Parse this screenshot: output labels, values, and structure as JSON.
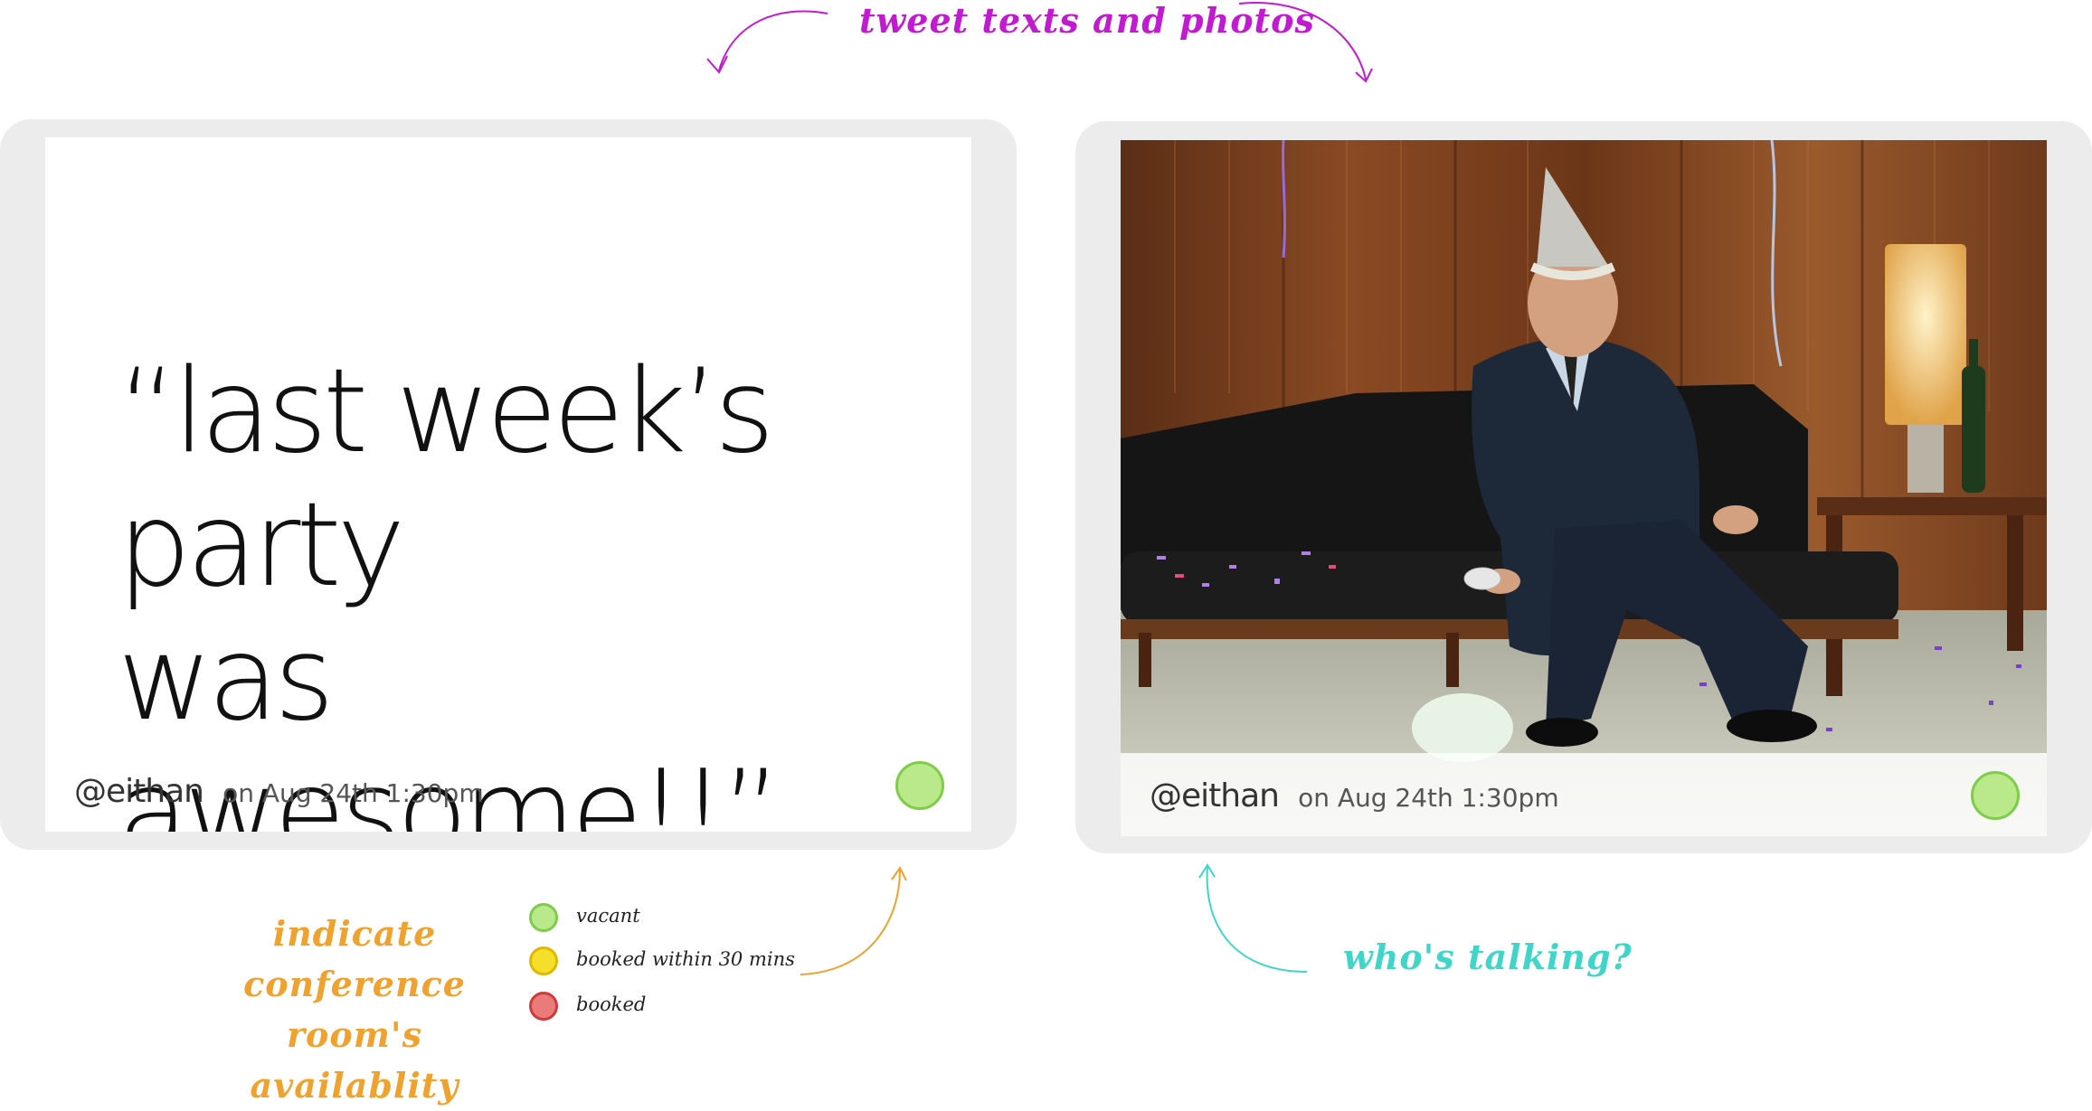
{
  "annotations": {
    "top": "tweet texts and photos",
    "availability": "indicate conference room's availablity",
    "who": "who's talking?"
  },
  "tweet_text_panel": {
    "quote": "“last week’s party\nwas awesome!!”",
    "handle": "@eithan",
    "time": "on Aug 24th 1:30pm",
    "status": "vacant"
  },
  "tweet_photo_panel": {
    "photo": "man in suit and party hat asleep on leather sofa after a party",
    "handle": "@eithan",
    "time": "on Aug 24th 1:30pm",
    "status": "vacant"
  },
  "legend": [
    {
      "label": "vacant",
      "color": "#b9e98b",
      "border": "#7fcc4a"
    },
    {
      "label": "booked within 30 mins",
      "color": "#f6df2a",
      "border": "#e1b800"
    },
    {
      "label": "booked",
      "color": "#ea7b7b",
      "border": "#cf3a3a"
    }
  ],
  "colors": {
    "top_note": "#c21ad1",
    "availability_note": "#f0a22e",
    "who_note": "#3fd6c9"
  }
}
